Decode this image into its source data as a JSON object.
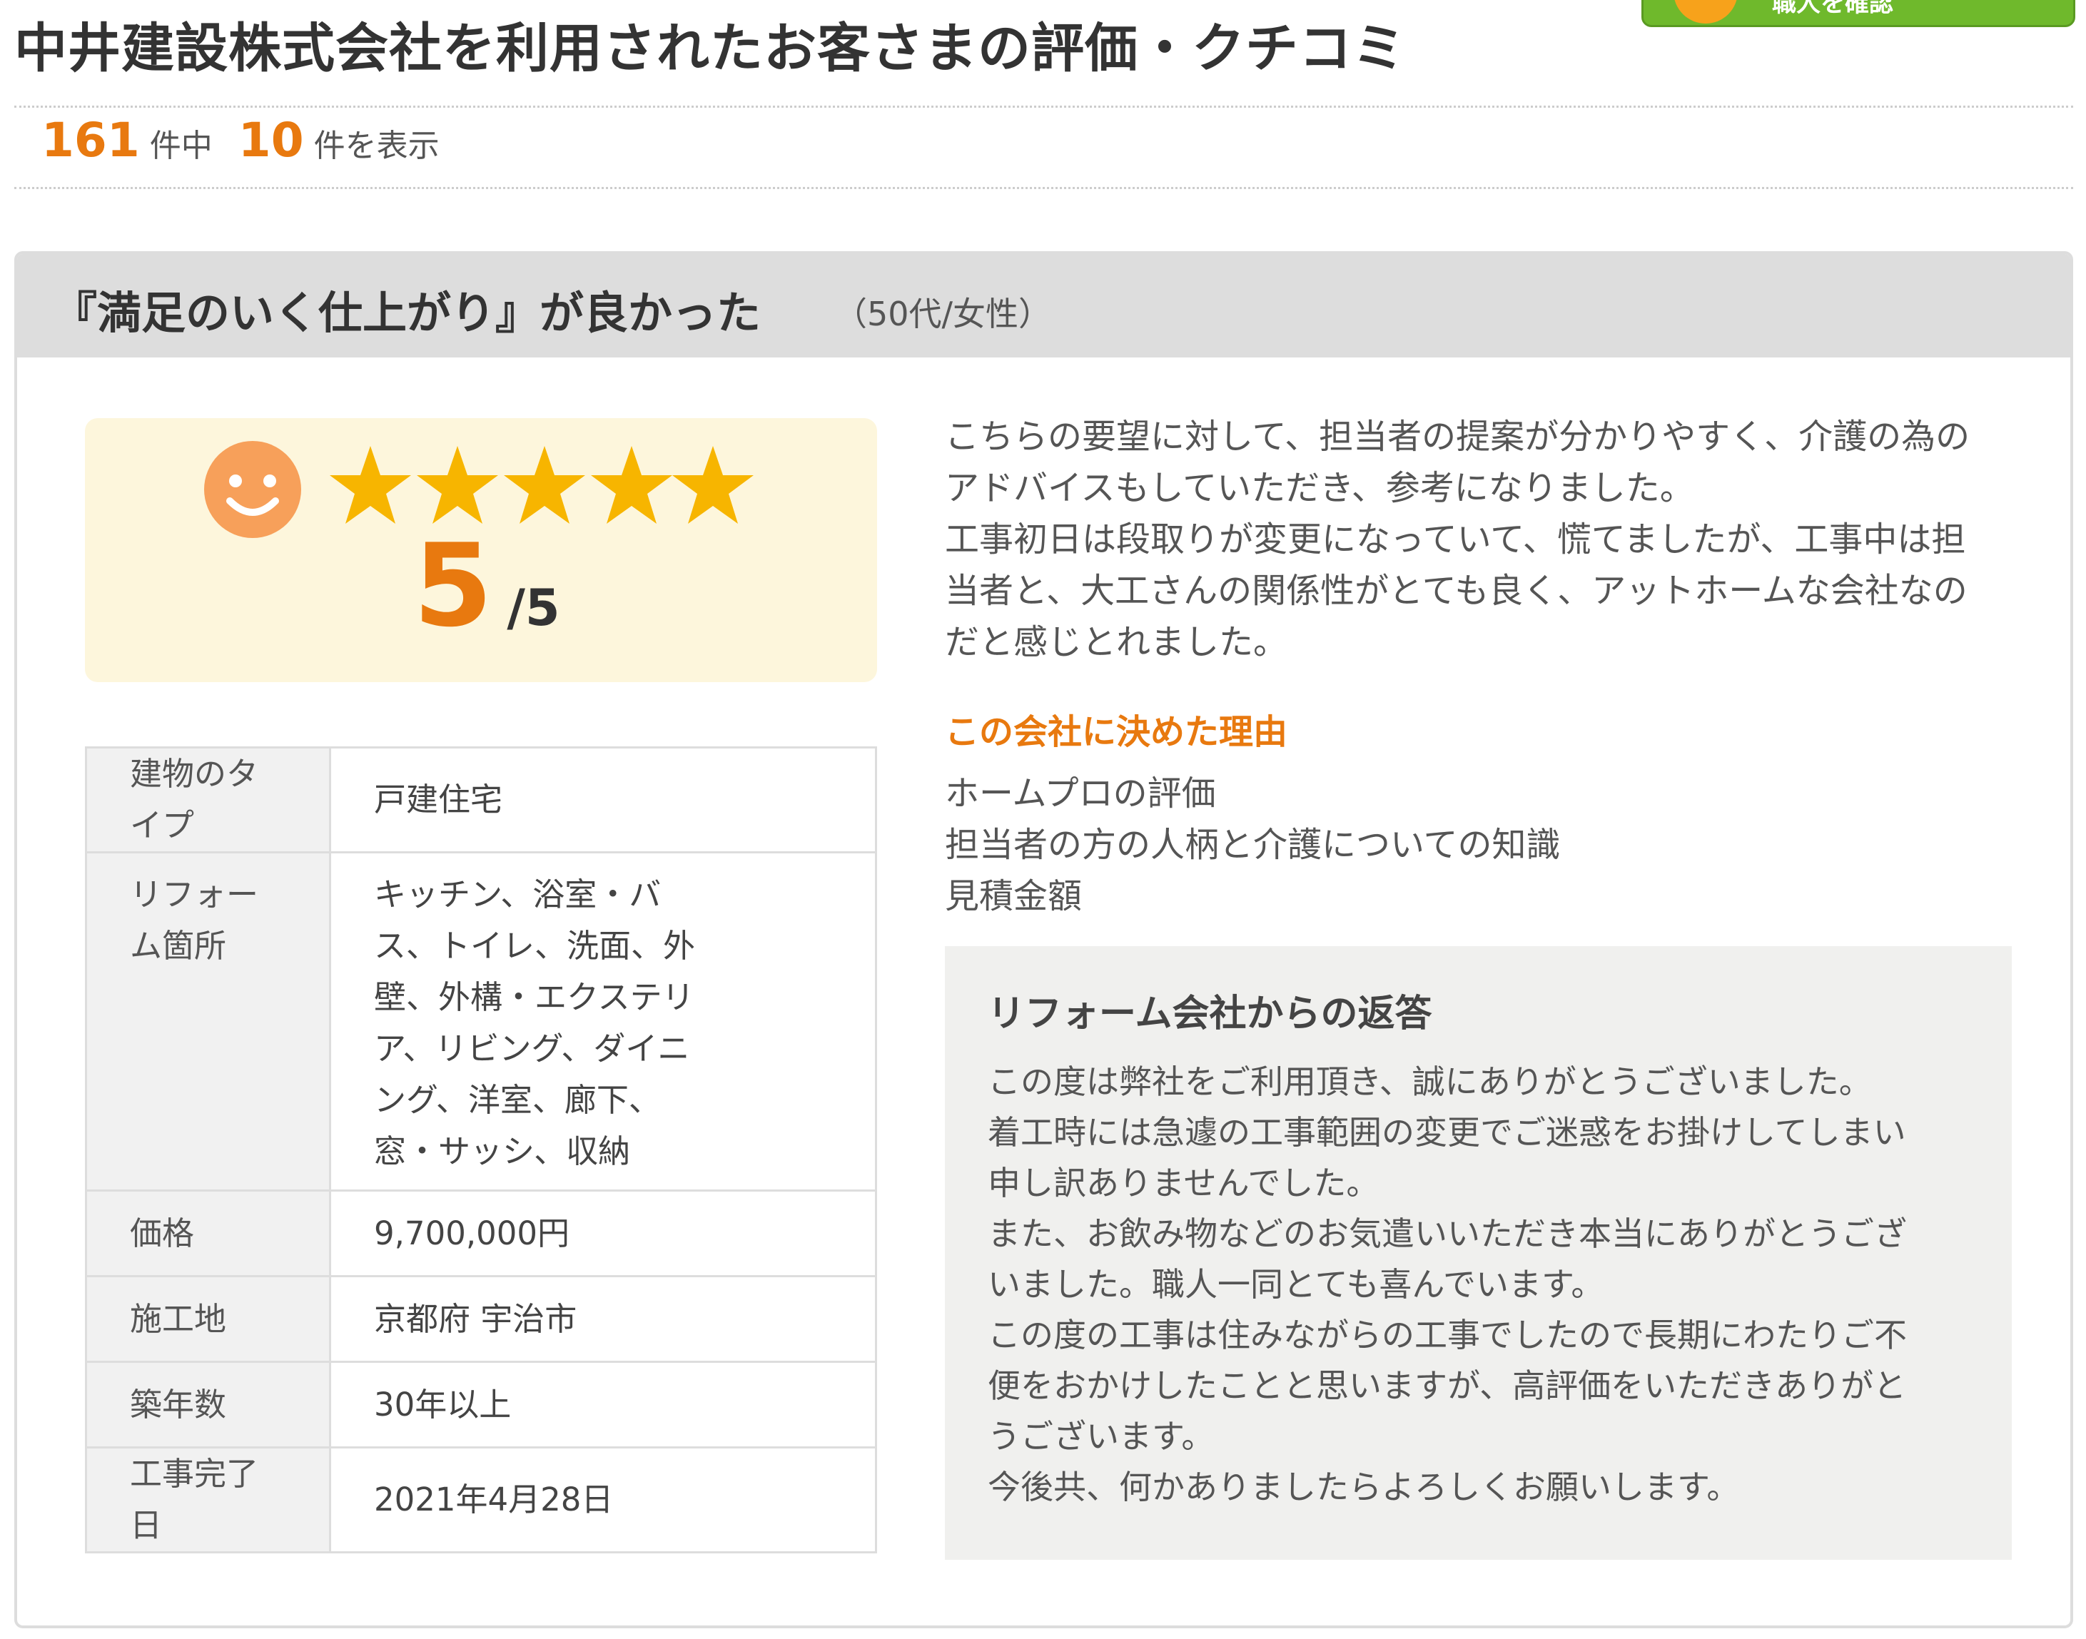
{
  "header": {
    "title": "中井建設株式会社を利用されたお客さまの評価・クチコミ",
    "top_button_label": "職人を確認"
  },
  "results": {
    "total": "161",
    "total_suffix": "件中",
    "shown": "10",
    "shown_suffix": "件を表示"
  },
  "review": {
    "title": "『満足のいく仕上がり』が良かった",
    "author_meta": "（50代/女性）",
    "rating": {
      "score": "5",
      "max": "/5",
      "stars": 5,
      "star_color": "#f7b500",
      "smiley_color": "#f7a05a"
    },
    "details": {
      "building_type_label": "建物のタイプ",
      "building_type_value": "戸建住宅",
      "reform_areas_label": "リフォーム箇所",
      "reform_areas_lines": [
        "キッチン、浴室・バ",
        "ス、トイレ、洗面、外",
        "壁、外構・エクステリ",
        "ア、リビング、ダイニ",
        "ング、洋室、廊下、",
        "窓・サッシ、収納"
      ],
      "price_label": "価格",
      "price_value": "9,700,000円",
      "location_label": "施工地",
      "location_value": "京都府 宇治市",
      "building_age_label": "築年数",
      "building_age_value": "30年以上",
      "completion_date_label": "工事完了日",
      "completion_date_value": "2021年4月28日"
    },
    "comment_lines": [
      "こちらの要望に対して、担当者の提案が分かりやすく、介護の為の",
      "アドバイスもしていただき、参考になりました。",
      "工事初日は段取りが変更になっていて、慌てましたが、工事中は担",
      "当者と、大工さんの関係性がとても良く、アットホームな会社なの",
      "だと感じとれました。"
    ],
    "reason_heading": "この会社に決めた理由",
    "reasons": [
      "ホームプロの評価",
      "担当者の方の人柄と介護についての知識",
      "見積金額"
    ],
    "reply": {
      "heading": "リフォーム会社からの返答",
      "lines": [
        "この度は弊社をご利用頂き、誠にありがとうございました。",
        "着工時には急遽の工事範囲の変更でご迷惑をお掛けしてしまい",
        "申し訳ありませんでした。",
        "また、お飲み物などのお気遣いいただき本当にありがとうござ",
        "いました。職人一同とても喜んでいます。",
        "この度の工事は住みながらの工事でしたので長期にわたりご不",
        "便をおかけしたことと思いますが、高評価をいただきありがと",
        "うございます。",
        "今後共、何かありましたらよろしくお願いします。"
      ]
    }
  }
}
